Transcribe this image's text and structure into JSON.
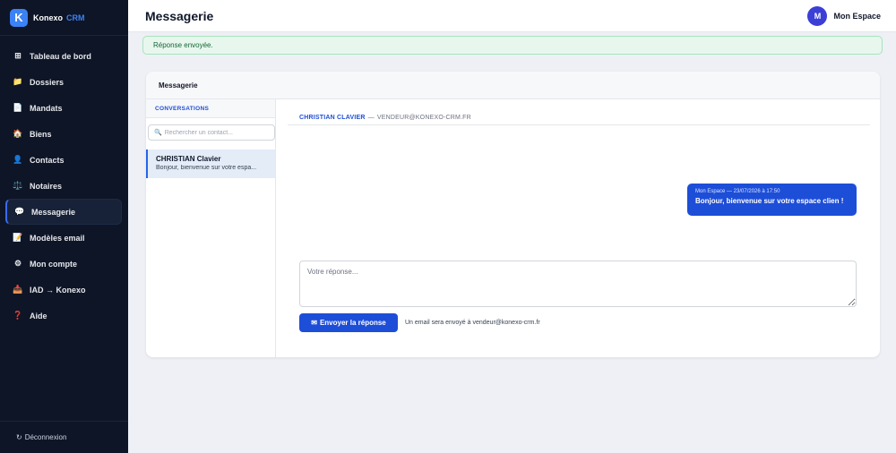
{
  "brand": {
    "logo_letter": "K",
    "name": "Konexo",
    "crm": "CRM"
  },
  "sidebar": {
    "items": [
      {
        "icon": "⊞",
        "label": "Tableau de bord",
        "active": false
      },
      {
        "icon": "📁",
        "label": "Dossiers",
        "active": false
      },
      {
        "icon": "📄",
        "label": "Mandats",
        "active": false
      },
      {
        "icon": "🏠",
        "label": "Biens",
        "active": false
      },
      {
        "icon": "👤",
        "label": "Contacts",
        "active": false
      },
      {
        "icon": "⚖️",
        "label": "Notaires",
        "active": false
      },
      {
        "icon": "💬",
        "label": "Messagerie",
        "active": true
      },
      {
        "icon": "📝",
        "label": "Modèles email",
        "active": false
      },
      {
        "icon": "⚙",
        "label": "Mon compte",
        "active": false
      },
      {
        "icon": "📥",
        "label": "IAD → Konexo",
        "active": false
      },
      {
        "icon": "❓",
        "label": "Aide",
        "active": false
      }
    ],
    "logout": {
      "icon": "↻",
      "label": "Déconnexion"
    }
  },
  "topbar": {
    "title": "Messagerie",
    "user_initial": "M",
    "user_name": "Mon Espace"
  },
  "flash": {
    "message": "Réponse envoyée."
  },
  "card": {
    "title": "Messagerie"
  },
  "conversations": {
    "heading": "CONVERSATIONS",
    "search_icon": "🔍",
    "search_placeholder": "Rechercher un contact...",
    "items": [
      {
        "name": "CHRISTIAN Clavier",
        "preview": "Bonjour, bienvenue sur votre espa..."
      }
    ]
  },
  "thread": {
    "contact_name": "CHRISTIAN CLAVIER",
    "separator": "—",
    "contact_email": "VENDEUR@KONEXO-CRM.FR",
    "messages": [
      {
        "meta": "Mon Espace — 23/07/2026 à 17:50",
        "text": "Bonjour, bienvenue sur votre espace clien !"
      }
    ]
  },
  "reply": {
    "placeholder": "Votre réponse...",
    "value": "",
    "send_icon": "✉",
    "send_label": "Envoyer la réponse",
    "hint": "Un email sera envoyé à vendeur@konexo-crm.fr"
  },
  "colors": {
    "sidebar_bg": "#0e1526",
    "accent": "#1d4ed8",
    "flash_bg": "#e7f7ee",
    "avatar": "#3b3fd6"
  }
}
